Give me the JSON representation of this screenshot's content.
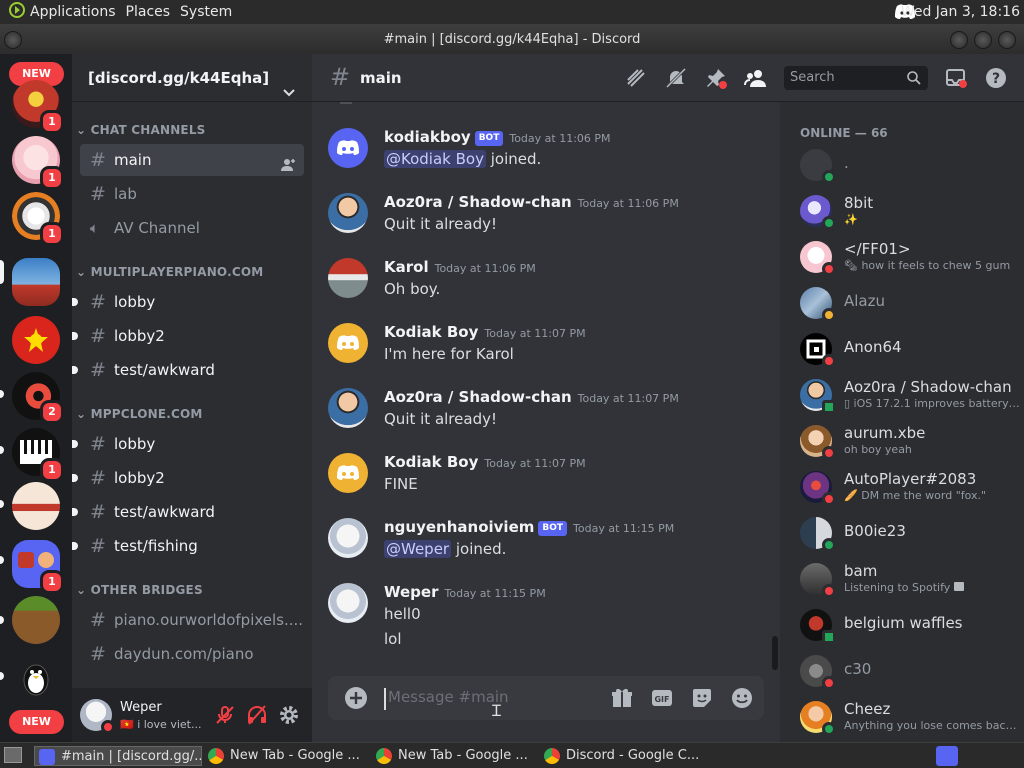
{
  "os": {
    "menus": [
      "Applications",
      "Places",
      "System"
    ],
    "clock": "Wed Jan  3, 18:16"
  },
  "window": {
    "title": "#main | [discord.gg/k44Eqha] - Discord"
  },
  "guilds": {
    "new_label": "NEW",
    "badges": [
      "1",
      "1",
      "1",
      "2",
      "1",
      "1"
    ]
  },
  "server": {
    "name": "[discord.gg/k44Eqha]",
    "categories": {
      "chat": "CHAT CHANNELS",
      "mpp": "MULTIPLAYERPIANO.COM",
      "mppclone": "MPPCLONE.COM",
      "other": "OTHER BRIDGES"
    },
    "channels": {
      "main": "main",
      "lab": "lab",
      "av": "AV Channel",
      "mpp_lobby": "lobby",
      "mpp_lobby2": "lobby2",
      "mpp_test": "test/awkward",
      "clone_lobby": "lobby",
      "clone_lobby2": "lobby2",
      "clone_test": "test/awkward",
      "clone_fishing": "test/fishing",
      "owop": "piano.ourworldofpixels....",
      "daydun": "daydun.com/piano"
    }
  },
  "user": {
    "name": "Weper",
    "status": "i love viet..."
  },
  "chat": {
    "channel": "main",
    "search_placeholder": "Search",
    "composer_placeholder": "Message #main",
    "messages": [
      {
        "author": "kodiakboy",
        "tag": "BOT",
        "time": "Today at 11:06 PM",
        "mention": "@Kodiak Boy",
        "text": "joined."
      },
      {
        "author": "Aoz0ra / Shadow-chan",
        "time": "Today at 11:06 PM",
        "text": "Quit it already!"
      },
      {
        "author": "Karol",
        "time": "Today at 11:06 PM",
        "text": "Oh boy."
      },
      {
        "author": "Kodiak Boy",
        "time": "Today at 11:07 PM",
        "text": "I'm here for Karol"
      },
      {
        "author": "Aoz0ra / Shadow-chan",
        "time": "Today at 11:07 PM",
        "text": "Quit it already!"
      },
      {
        "author": "Kodiak Boy",
        "time": "Today at 11:07 PM",
        "text": "FINE"
      },
      {
        "author": "nguyenhanoiviem",
        "tag": "BOT",
        "time": "Today at 11:15 PM",
        "mention": "@Weper",
        "text": "joined."
      },
      {
        "author": "Weper",
        "time": "Today at 11:15 PM",
        "text": "hell0",
        "text2": "lol"
      }
    ]
  },
  "members": {
    "header": "ONLINE — 66",
    "list": [
      {
        "name": ".",
        "activity": ""
      },
      {
        "name": "8bit",
        "activity": "✨"
      },
      {
        "name": "</FF01>",
        "activity": "🗞 how it feels to chew 5 gum"
      },
      {
        "name": "Alazu",
        "activity": ""
      },
      {
        "name": "Anon64",
        "activity": ""
      },
      {
        "name": "Aoz0ra / Shadow-chan",
        "activity": "▯ iOS 17.2.1 improves battery li..."
      },
      {
        "name": "aurum.xbe",
        "activity": "oh boy yeah"
      },
      {
        "name": "AutoPlayer#2083",
        "activity": "🥖 DM me the word \"fox.\""
      },
      {
        "name": "B00ie23",
        "activity": ""
      },
      {
        "name": "bam",
        "activity": "Listening to Spotify"
      },
      {
        "name": "belgium waffles",
        "activity": ""
      },
      {
        "name": "c30",
        "activity": ""
      },
      {
        "name": "Cheez",
        "activity": "Anything you lose comes back..."
      }
    ]
  },
  "taskbar": {
    "items": [
      "#main | [discord.gg/...",
      "New Tab - Google ...",
      "New Tab - Google ...",
      "Discord - Google C..."
    ]
  },
  "colors": {
    "online": "#23a55a",
    "dnd": "#f23f43",
    "idle": "#f0b232",
    "blurple": "#5865f2"
  }
}
